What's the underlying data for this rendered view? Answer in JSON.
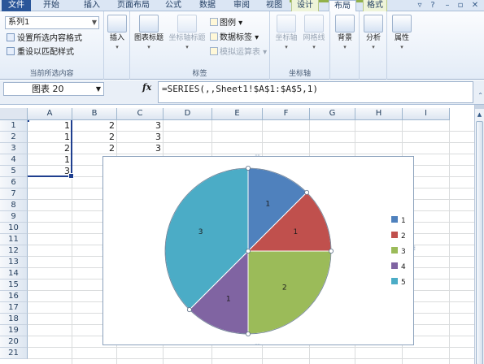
{
  "ribbon": {
    "tabs": [
      "文件",
      "开始",
      "插入",
      "页面布局",
      "公式",
      "数据",
      "审阅",
      "视图",
      "设计",
      "布局",
      "格式"
    ],
    "active_tab": "布局",
    "current_selection": {
      "dropdown_value": "系列1",
      "format_selection": "设置所选内容格式",
      "reset_style": "重设以匹配样式",
      "label": "当前所选内容"
    },
    "insert": {
      "label": "插入"
    },
    "labels_group": {
      "chart_title": "图表标题",
      "axis_title": "坐标轴标题",
      "legend": "图例",
      "data_labels": "数据标签",
      "data_table": "模拟运算表",
      "label": "标签"
    },
    "axes_group": {
      "axes": "坐标轴",
      "gridlines": "网格线",
      "label": "坐标轴"
    },
    "background": {
      "label": "背景"
    },
    "analysis": {
      "label": "分析"
    },
    "properties": {
      "label": "属性"
    }
  },
  "formula_bar": {
    "name_box": "图表 20",
    "fx": "fx",
    "formula": "=SERIES(,,Sheet1!$A$1:$A$5,1)"
  },
  "sheet": {
    "columns": [
      "A",
      "B",
      "C",
      "D",
      "E",
      "F",
      "G",
      "H",
      "I"
    ],
    "rows": [
      "1",
      "2",
      "3",
      "4",
      "5",
      "6",
      "7",
      "8",
      "9",
      "10",
      "11",
      "12",
      "13",
      "14",
      "15",
      "16",
      "17",
      "18",
      "19",
      "20",
      "21"
    ],
    "data": [
      [
        "1",
        "2",
        "3"
      ],
      [
        "1",
        "2",
        "3"
      ],
      [
        "2",
        "2",
        "3"
      ],
      [
        "1",
        "2",
        "3"
      ],
      [
        "3",
        "",
        ""
      ]
    ]
  },
  "chart_data": {
    "type": "pie",
    "categories": [
      "1",
      "2",
      "3",
      "4",
      "5"
    ],
    "values": [
      1,
      1,
      2,
      1,
      3
    ],
    "data_labels": [
      "1",
      "1",
      "2",
      "1",
      "3"
    ],
    "legend": [
      "1",
      "2",
      "3",
      "4",
      "5"
    ],
    "legend_position": "right",
    "colors": [
      "#4f81bd",
      "#c0504d",
      "#9bbb59",
      "#8064a2",
      "#4bacc6"
    ],
    "title": ""
  }
}
